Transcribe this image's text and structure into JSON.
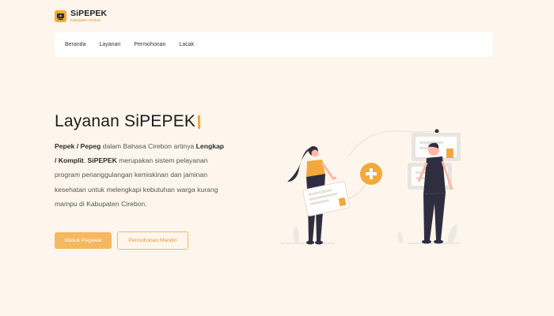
{
  "brand": {
    "name": "SiPEPEK",
    "subtitle": "Kabupaten Cirebon"
  },
  "nav": {
    "items": [
      "Beranda",
      "Layanan",
      "Permohonan",
      "Lacak"
    ]
  },
  "hero": {
    "title": "Layanan SiPEPEK",
    "desc": {
      "term1": "Pepek / Pepeg",
      "text1": " dalam Bahasa Cirebon artinya ",
      "term2": "Lengkap / Komplit",
      "text2": ". ",
      "term3": "SiPEPEK",
      "text3": " merupakan sistem pelayanan program penanggulangan kemiskinan dan jaminan kesehatan untuk melengkapi kebutuhan warga kurang mampu di Kabupaten Cirebon."
    },
    "btn_primary": "Masuk Pegawai",
    "btn_secondary": "Permohonan Mandiri"
  },
  "colors": {
    "accent": "#f2a93b",
    "background": "#fef6ec",
    "dark": "#2f2e41"
  }
}
